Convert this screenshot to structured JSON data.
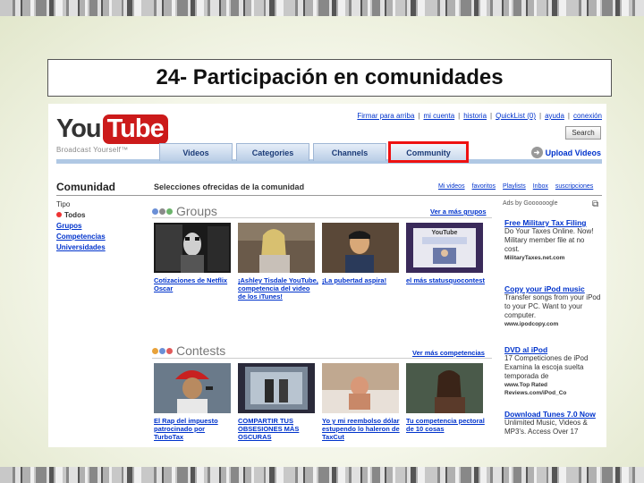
{
  "slide": {
    "title": "24- Participación en comunidades"
  },
  "header": {
    "logo_you": "You",
    "logo_tube": "Tube",
    "tagline": "Broadcast Yourself™",
    "links": [
      "Firmar para arriba",
      "|",
      "mi cuenta",
      "|",
      "historia",
      "|",
      "QuickList (0)",
      "|",
      "ayuda",
      "|",
      "conexión"
    ],
    "search_button": "Search",
    "tabs": [
      "Videos",
      "Categories",
      "Channels",
      "Community"
    ],
    "upload_label": "Upload Videos"
  },
  "community": {
    "title": "Comunidad",
    "subtitle": "Selecciones ofrecidas de la comunidad",
    "header_links": [
      "Mi videos",
      "favoritos",
      "Playlists",
      "Inbox",
      "suscripciones"
    ],
    "filter_label": "Tipo",
    "filters": [
      "Todos",
      "Grupos",
      "Competencias",
      "Universidades"
    ]
  },
  "groups": {
    "heading": "Groups",
    "more_link": "Ver a más grupos",
    "items": [
      {
        "caption": "Cotizaciones de Netflix Oscar"
      },
      {
        "caption": "¡Ashley Tisdale YouTube, competencia del video de los iTunes!"
      },
      {
        "caption": "¡La pubertad aspira!"
      },
      {
        "caption": "el más statusquocontest",
        "thumb_text": "YouTube"
      }
    ]
  },
  "contests": {
    "heading": "Contests",
    "more_link": "Ver más competencias",
    "items": [
      {
        "caption": "El Rap del impuesto patrocinado por TurboTax"
      },
      {
        "caption": "COMPARTIR TUS OBSESIONES MÁS OSCURAS"
      },
      {
        "caption": "Yo y mi reembolso dólar estupendo lo haleron de TaxCut"
      },
      {
        "caption": "Tu competencia pectoral de 10 cosas"
      }
    ]
  },
  "ads": {
    "header": "Ads by Goooooogle",
    "items": [
      {
        "title": "Free Military Tax Filing",
        "desc": "Do Your Taxes Online. Now! Military member file at no cost.",
        "url": "MilitaryTaxes.net.com"
      },
      {
        "title": "Copy your iPod music",
        "desc": "Transfer songs from your iPod to your PC. Want to your computer.",
        "url": "www.ipodcopy.com"
      },
      {
        "title": "DVD al iPod",
        "desc": "17 Competiciones de iPod Examina la escoja suelta temporada de",
        "url": "www.Top Rated Reviews.com/iPod_Co"
      },
      {
        "title": "Download Tunes 7.0 Now",
        "desc": "Unlimited Music, Videos & MP3's. Access Over 17",
        "url": ""
      }
    ]
  },
  "colors": {
    "link": "#0033cc",
    "highlight": "#ee1111",
    "logo_red": "#cc1a1a"
  }
}
